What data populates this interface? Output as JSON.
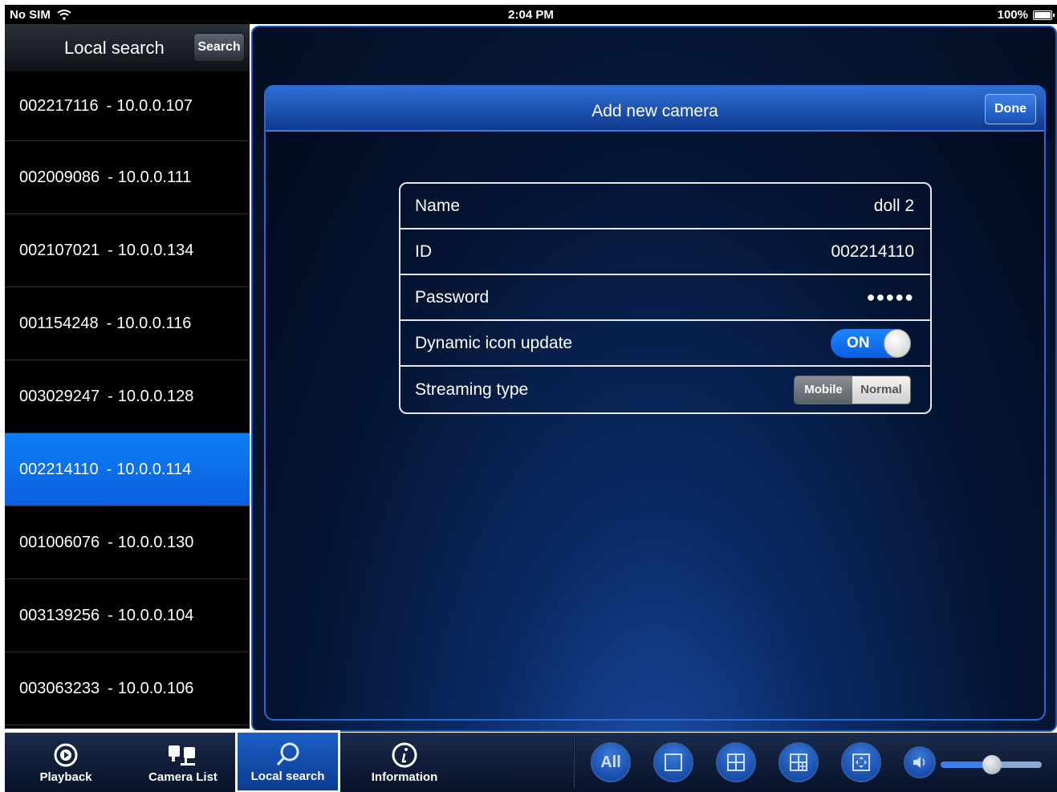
{
  "status_bar": {
    "carrier": "No SIM",
    "time": "2:04 PM",
    "battery": "100%"
  },
  "sidebar": {
    "title": "Local search",
    "search_label": "Search",
    "items": [
      {
        "id": "002217116",
        "ip": "10.0.0.107"
      },
      {
        "id": "002009086",
        "ip": "10.0.0.111"
      },
      {
        "id": "002107021",
        "ip": "10.0.0.134"
      },
      {
        "id": "001154248",
        "ip": "10.0.0.116"
      },
      {
        "id": "003029247",
        "ip": "10.0.0.128"
      },
      {
        "id": "002214110",
        "ip": "10.0.0.114"
      },
      {
        "id": "001006076",
        "ip": "10.0.0.130"
      },
      {
        "id": "003139256",
        "ip": "10.0.0.104"
      },
      {
        "id": "003063233",
        "ip": "10.0.0.106"
      }
    ],
    "separator": "-",
    "selected_index": 5
  },
  "dialog": {
    "title": "Add new camera",
    "done_label": "Done",
    "fields": {
      "name": {
        "label": "Name",
        "value": "doll 2"
      },
      "id": {
        "label": "ID",
        "value": "002214110"
      },
      "password": {
        "label": "Password",
        "value": "●●●●●"
      },
      "dynamic_icon": {
        "label": "Dynamic icon update",
        "toggle_label": "ON"
      },
      "streaming": {
        "label": "Streaming type",
        "option_mobile": "Mobile",
        "option_normal": "Normal"
      }
    }
  },
  "toolbar": {
    "tabs": [
      {
        "label": "Playback",
        "icon": "playback-icon"
      },
      {
        "label": "Camera List",
        "icon": "camera-list-icon"
      },
      {
        "label": "Local search",
        "icon": "search-icon"
      },
      {
        "label": "Information",
        "icon": "info-icon"
      }
    ],
    "view_all_label": "All",
    "volume_level": 0.5
  },
  "colors": {
    "selected_row": "#0c6ef0",
    "accent": "#1c86ff"
  }
}
